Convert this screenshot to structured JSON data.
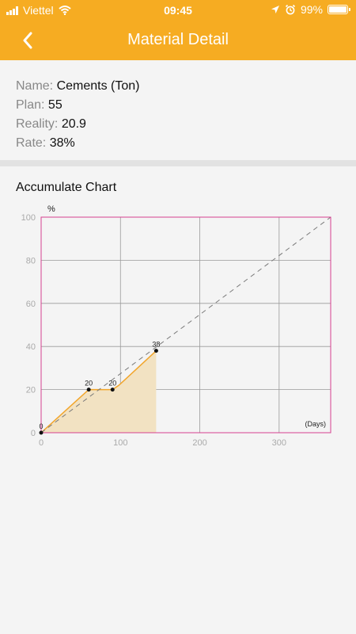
{
  "status_bar": {
    "carrier": "Viettel",
    "time": "09:45",
    "battery": "99%",
    "battery_level": 0.99
  },
  "header": {
    "title": "Material Detail",
    "back_icon": "chevron-left-icon"
  },
  "material": {
    "name_label": "Name:",
    "name_value": "Cements (Ton)",
    "plan_label": "Plan:",
    "plan_value": "55",
    "reality_label": "Reality:",
    "reality_value": "20.9",
    "rate_label": "Rate:",
    "rate_value": "38%"
  },
  "chart_section": {
    "title": "Accumulate Chart"
  },
  "colors": {
    "accent": "#f6ac22",
    "plot_border": "#d6418f",
    "grid": "#9a9a9a",
    "line": "#f2a52a",
    "area": "#f2e2c2",
    "plan": "#7a7a7a"
  },
  "chart_data": {
    "type": "area",
    "ylabel": "%",
    "xlabel": "(Days)",
    "xlim": [
      0,
      365
    ],
    "ylim": [
      0,
      100
    ],
    "xticks": [
      0,
      100,
      200,
      300
    ],
    "yticks": [
      0,
      20,
      40,
      60,
      80,
      100
    ],
    "grid": true,
    "actual": {
      "x": [
        0,
        60,
        72,
        90,
        98,
        145,
        145
      ],
      "y": [
        0,
        20,
        20,
        20,
        22,
        38,
        0
      ]
    },
    "markers": [
      {
        "x": 0,
        "y": 0,
        "label": "0"
      },
      {
        "x": 60,
        "y": 20,
        "label": "20"
      },
      {
        "x": 90,
        "y": 20,
        "label": "20"
      },
      {
        "x": 145,
        "y": 38,
        "label": "38"
      }
    ],
    "plan": {
      "x": [
        0,
        365
      ],
      "y": [
        0,
        100
      ]
    }
  }
}
